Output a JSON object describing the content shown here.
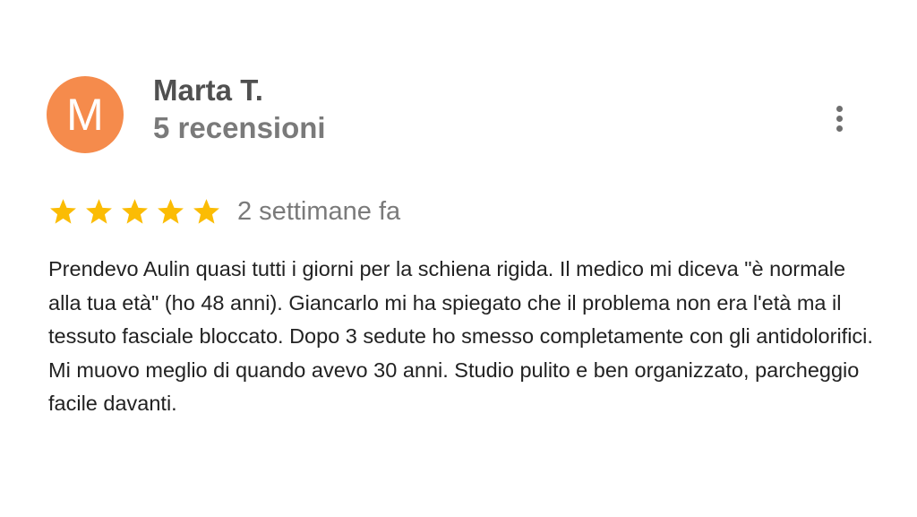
{
  "review": {
    "avatar": {
      "letter": "M",
      "color": "#F58B4C"
    },
    "reviewer_name": "Marta T.",
    "review_count": "5 recensioni",
    "more_options_icon": "more-vertical-icon",
    "rating": {
      "stars": 5,
      "max": 5,
      "star_color": "#FBBC04"
    },
    "time_ago": "2 settimane fa",
    "text": "Prendevo Aulin quasi tutti i giorni per la schiena rigida. Il medico mi diceva \"è normale alla tua età\" (ho 48 anni). Giancarlo mi ha spiegato che il problema non era l'età ma il tessuto fasciale bloccato. Dopo 3 sedute ho smesso completamente con gli antidolorifici. Mi muovo meglio di quando avevo 30 anni. Studio pulito e ben organizzato, parcheggio facile davanti."
  }
}
